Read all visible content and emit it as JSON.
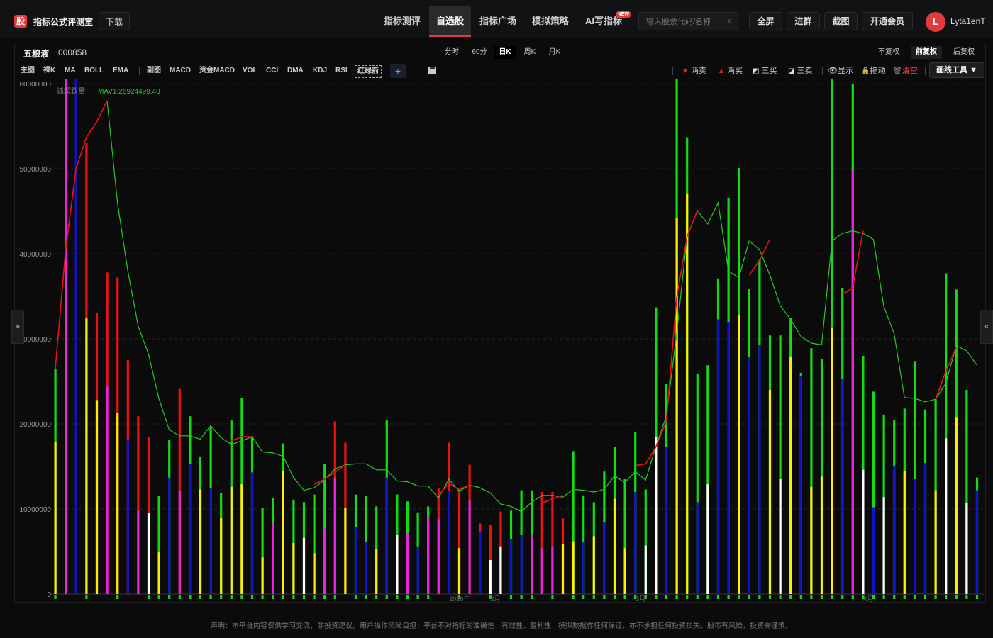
{
  "app": {
    "logo_char": "股",
    "title": "指标公式评测室",
    "download": "下载"
  },
  "nav": [
    "指标测评",
    "自选股",
    "指标广场",
    "模拟策略",
    "AI写指标"
  ],
  "nav_active": 1,
  "new_badge": "NEW",
  "search": {
    "placeholder": "输入股票代码/名称"
  },
  "top_buttons": [
    "全屏",
    "进群",
    "截图",
    "开通会员"
  ],
  "user": {
    "initial": "L",
    "name": "Lyta1enT"
  },
  "stock": {
    "name": "五粮液",
    "code": "000858"
  },
  "periods": [
    "分时",
    "60分",
    "日K",
    "周K",
    "月K"
  ],
  "period_active": 2,
  "adjust": [
    "不复权",
    "前复权",
    "后复权"
  ],
  "adjust_active": 1,
  "indicators_main": [
    "主图",
    "裸K",
    "MA",
    "BOLL",
    "EMA"
  ],
  "indicators_sub": [
    "副图",
    "MACD",
    "资金MACD",
    "VOL",
    "CCI",
    "DMA",
    "KDJ",
    "RSI",
    "红绿箭"
  ],
  "add_label": "+",
  "draw_tools": [
    "两卖",
    "两买",
    "三买",
    "三卖",
    "显示",
    "拖动",
    "清空"
  ],
  "draw_tools_button": "画线工具 ▼",
  "side_left": "»",
  "side_right": "«",
  "disclaimer": "声明：本平台内容仅供学习交流，非投资建议。用户操作风险自担；平台不对指标的准确性、有效性、盈利性、模拟数据作任何保证，亦不承担任何投资损失。股市有风险，投资需谨慎。",
  "chart_data": {
    "type": "bar",
    "legend": [
      {
        "name": "抓超跌量",
        "color": "#888888"
      },
      {
        "name": "MAV1:26924499.40",
        "color": "#22cc22"
      }
    ],
    "y_ticks": [
      0,
      10000000,
      20000000,
      30000000,
      40000000,
      50000000,
      60000000
    ],
    "ylim": [
      0,
      60000000
    ],
    "x_labels": [
      {
        "index": 39,
        "text": "2026年"
      },
      {
        "index": 43,
        "text": "2月"
      },
      {
        "index": 57,
        "text": "3月"
      },
      {
        "index": 79,
        "text": "4月"
      }
    ],
    "colors": {
      "yellow": "#ffee00",
      "green": "#11dd11",
      "red": "#ee1111",
      "blue": "#1111cc",
      "magenta": "#ee22dd",
      "white": "#ffffff"
    },
    "bars": [
      {
        "upper": "green",
        "upper_val": 26500000,
        "lower": "yellow",
        "lower_val": 17900000
      },
      {
        "upper": "magenta",
        "upper_val": 60500000,
        "lower": "magenta",
        "lower_val": 60500000
      },
      {
        "upper": "blue",
        "upper_val": 60500000,
        "lower": "blue",
        "lower_val": 60500000
      },
      {
        "upper": "red",
        "upper_val": 53000000,
        "lower": "yellow",
        "lower_val": 32400000
      },
      {
        "upper": "red",
        "upper_val": 33000000,
        "lower": "yellow",
        "lower_val": 22800000
      },
      {
        "upper": "red",
        "upper_val": 37800000,
        "lower": "magenta",
        "lower_val": 24400000
      },
      {
        "upper": "red",
        "upper_val": 37200000,
        "lower": "yellow",
        "lower_val": 21300000
      },
      {
        "upper": "red",
        "upper_val": 27500000,
        "lower": "blue",
        "lower_val": 18100000
      },
      {
        "upper": "red",
        "upper_val": 20900000,
        "lower": "magenta",
        "lower_val": 9800000
      },
      {
        "upper": "red",
        "upper_val": 18500000,
        "lower": "white",
        "lower_val": 9500000
      },
      {
        "upper": "green",
        "upper_val": 11500000,
        "lower": "yellow",
        "lower_val": 4900000
      },
      {
        "upper": "green",
        "upper_val": 18100000,
        "lower": "blue",
        "lower_val": 13700000
      },
      {
        "upper": "red",
        "upper_val": 24100000,
        "lower": "magenta",
        "lower_val": 12100000
      },
      {
        "upper": "green",
        "upper_val": 20900000,
        "lower": "blue",
        "lower_val": 15300000
      },
      {
        "upper": "green",
        "upper_val": 16100000,
        "lower": "yellow",
        "lower_val": 12300000
      },
      {
        "upper": "green",
        "upper_val": 19600000,
        "lower": "blue",
        "lower_val": 12500000
      },
      {
        "upper": "green",
        "upper_val": 11900000,
        "lower": "yellow",
        "lower_val": 8900000
      },
      {
        "upper": "green",
        "upper_val": 20400000,
        "lower": "yellow",
        "lower_val": 12600000
      },
      {
        "upper": "green",
        "upper_val": 23000000,
        "lower": "yellow",
        "lower_val": 12900000
      },
      {
        "upper": "green",
        "upper_val": 18400000,
        "lower": "blue",
        "lower_val": 14300000
      },
      {
        "upper": "green",
        "upper_val": 10100000,
        "lower": "yellow",
        "lower_val": 4300000
      },
      {
        "upper": "green",
        "upper_val": 11300000,
        "lower": "magenta",
        "lower_val": 8300000
      },
      {
        "upper": "green",
        "upper_val": 17700000,
        "lower": "yellow",
        "lower_val": 14500000
      },
      {
        "upper": "green",
        "upper_val": 11100000,
        "lower": "yellow",
        "lower_val": 6000000
      },
      {
        "upper": "green",
        "upper_val": 10800000,
        "lower": "white",
        "lower_val": 6600000
      },
      {
        "upper": "green",
        "upper_val": 11700000,
        "lower": "yellow",
        "lower_val": 4800000
      },
      {
        "upper": "green",
        "upper_val": 15300000,
        "lower": "magenta",
        "lower_val": 7700000
      },
      {
        "upper": "red",
        "upper_val": 20300000,
        "lower": "magenta",
        "lower_val": 13700000
      },
      {
        "upper": "red",
        "upper_val": 17800000,
        "lower": "yellow",
        "lower_val": 10100000
      },
      {
        "upper": "green",
        "upper_val": 11700000,
        "lower": "blue",
        "lower_val": 7900000
      },
      {
        "upper": "green",
        "upper_val": 11500000,
        "lower": "blue",
        "lower_val": 6100000
      },
      {
        "upper": "green",
        "upper_val": 10300000,
        "lower": "yellow",
        "lower_val": 5300000
      },
      {
        "upper": "green",
        "upper_val": 20500000,
        "lower": "blue",
        "lower_val": 13700000
      },
      {
        "upper": "green",
        "upper_val": 11700000,
        "lower": "white",
        "lower_val": 7000000
      },
      {
        "upper": "green",
        "upper_val": 10900000,
        "lower": "magenta",
        "lower_val": 7100000
      },
      {
        "upper": "green",
        "upper_val": 9600000,
        "lower": "blue",
        "lower_val": 5600000
      },
      {
        "upper": "green",
        "upper_val": 10300000,
        "lower": "magenta",
        "lower_val": 9000000
      },
      {
        "upper": "red",
        "upper_val": 12400000,
        "lower": "magenta",
        "lower_val": 8800000
      },
      {
        "upper": "red",
        "upper_val": 17800000,
        "lower": "blue",
        "lower_val": 12100000
      },
      {
        "upper": "red",
        "upper_val": 12300000,
        "lower": "yellow",
        "lower_val": 5400000
      },
      {
        "upper": "red",
        "upper_val": 15200000,
        "lower": "magenta",
        "lower_val": 11000000
      },
      {
        "upper": "red",
        "upper_val": 8300000,
        "lower": "blue",
        "lower_val": 7300000
      },
      {
        "upper": "red",
        "upper_val": 8100000,
        "lower": "white",
        "lower_val": 4000000
      },
      {
        "upper": "red",
        "upper_val": 9700000,
        "lower": "white",
        "lower_val": 5600000
      },
      {
        "upper": "green",
        "upper_val": 9800000,
        "lower": "blue",
        "lower_val": 6500000
      },
      {
        "upper": "green",
        "upper_val": 12200000,
        "lower": "blue",
        "lower_val": 7000000
      },
      {
        "upper": "green",
        "upper_val": 12200000,
        "lower": "magenta",
        "lower_val": 7000000
      },
      {
        "upper": "red",
        "upper_val": 12000000,
        "lower": "magenta",
        "lower_val": 5400000
      },
      {
        "upper": "red",
        "upper_val": 12000000,
        "lower": "magenta",
        "lower_val": 5600000
      },
      {
        "upper": "red",
        "upper_val": 8900000,
        "lower": "yellow",
        "lower_val": 5900000
      },
      {
        "upper": "green",
        "upper_val": 16800000,
        "lower": "yellow",
        "lower_val": 6200000
      },
      {
        "upper": "green",
        "upper_val": 11600000,
        "lower": "blue",
        "lower_val": 6100000
      },
      {
        "upper": "green",
        "upper_val": 10800000,
        "lower": "yellow",
        "lower_val": 6800000
      },
      {
        "upper": "green",
        "upper_val": 14400000,
        "lower": "blue",
        "lower_val": 8400000
      },
      {
        "upper": "green",
        "upper_val": 17300000,
        "lower": "yellow",
        "lower_val": 11200000
      },
      {
        "upper": "green",
        "upper_val": 13500000,
        "lower": "yellow",
        "lower_val": 5400000
      },
      {
        "upper": "green",
        "upper_val": 19000000,
        "lower": "blue",
        "lower_val": 12000000
      },
      {
        "upper": "green",
        "upper_val": 12300000,
        "lower": "white",
        "lower_val": 5700000
      },
      {
        "upper": "green",
        "upper_val": 33700000,
        "lower": "white",
        "lower_val": 18500000
      },
      {
        "upper": "green",
        "upper_val": 24700000,
        "lower": "blue",
        "lower_val": 17300000
      },
      {
        "upper": "green",
        "upper_val": 60500000,
        "lower": "yellow",
        "lower_val": 44200000
      },
      {
        "upper": "green",
        "upper_val": 53700000,
        "lower": "yellow",
        "lower_val": 47100000
      },
      {
        "upper": "green",
        "upper_val": 25900000,
        "lower": "blue",
        "lower_val": 10800000
      },
      {
        "upper": "green",
        "upper_val": 26900000,
        "lower": "white",
        "lower_val": 12900000
      },
      {
        "upper": "green",
        "upper_val": 37100000,
        "lower": "blue",
        "lower_val": 32300000
      },
      {
        "upper": "green",
        "upper_val": 46600000,
        "lower": "blue",
        "lower_val": 32000000
      },
      {
        "upper": "green",
        "upper_val": 50100000,
        "lower": "yellow",
        "lower_val": 32800000
      },
      {
        "upper": "green",
        "upper_val": 35900000,
        "lower": "blue",
        "lower_val": 27900000
      },
      {
        "upper": "green",
        "upper_val": 39300000,
        "lower": "blue",
        "lower_val": 29300000
      },
      {
        "upper": "green",
        "upper_val": 30400000,
        "lower": "yellow",
        "lower_val": 24000000
      },
      {
        "upper": "green",
        "upper_val": 30400000,
        "lower": "white",
        "lower_val": 13500000
      },
      {
        "upper": "green",
        "upper_val": 32500000,
        "lower": "yellow",
        "lower_val": 27900000
      },
      {
        "upper": "green",
        "upper_val": 26000000,
        "lower": "blue",
        "lower_val": 25600000
      },
      {
        "upper": "green",
        "upper_val": 28900000,
        "lower": "yellow",
        "lower_val": 12600000
      },
      {
        "upper": "green",
        "upper_val": 27600000,
        "lower": "yellow",
        "lower_val": 13800000
      },
      {
        "upper": "green",
        "upper_val": 60500000,
        "lower": "yellow",
        "lower_val": 31300000
      },
      {
        "upper": "green",
        "upper_val": 36000000,
        "lower": "blue",
        "lower_val": 25300000
      },
      {
        "upper": "green",
        "upper_val": 60000000,
        "lower": "magenta",
        "lower_val": 49800000
      },
      {
        "upper": "green",
        "upper_val": 28000000,
        "lower": "white",
        "lower_val": 14600000
      },
      {
        "upper": "green",
        "upper_val": 23800000,
        "lower": "blue",
        "lower_val": 10200000
      },
      {
        "upper": "green",
        "upper_val": 21100000,
        "lower": "white",
        "lower_val": 11400000
      },
      {
        "upper": "green",
        "upper_val": 20400000,
        "lower": "blue",
        "lower_val": 15100000
      },
      {
        "upper": "green",
        "upper_val": 21800000,
        "lower": "yellow",
        "lower_val": 14500000
      },
      {
        "upper": "green",
        "upper_val": 27400000,
        "lower": "blue",
        "lower_val": 13500000
      },
      {
        "upper": "green",
        "upper_val": 21700000,
        "lower": "blue",
        "lower_val": 15400000
      },
      {
        "upper": "green",
        "upper_val": 22900000,
        "lower": "yellow",
        "lower_val": 12200000
      },
      {
        "upper": "green",
        "upper_val": 37700000,
        "lower": "white",
        "lower_val": 18300000
      },
      {
        "upper": "green",
        "upper_val": 35800000,
        "lower": "yellow",
        "lower_val": 20800000
      },
      {
        "upper": "green",
        "upper_val": 24000000,
        "lower": "white",
        "lower_val": 10700000
      },
      {
        "upper": "green",
        "upper_val": 13700000,
        "lower": "blue",
        "lower_val": 12200000
      }
    ],
    "mav1": [
      null,
      null,
      null,
      null,
      null,
      58000000,
      46000000,
      38000000,
      31500000,
      28200000,
      23000000,
      19300000,
      18600000,
      18600000,
      18200000,
      19800000,
      18400000,
      17600000,
      18000000,
      18500000,
      16700000,
      16600000,
      16200000,
      13700000,
      12200000,
      12500000,
      13400000,
      14700000,
      15200000,
      15300000,
      15300000,
      14600000,
      14600000,
      13300000,
      13200000,
      12700000,
      12700000,
      11300000,
      13500000,
      12100000,
      12800000,
      12500000,
      11900000,
      10600000,
      10300000,
      9700000,
      10800000,
      11600000,
      11600000,
      11400000,
      12300000,
      12200000,
      12000000,
      12300000,
      13900000,
      13100000,
      14400000,
      13400000,
      17400000,
      20900000,
      30600000,
      42000000,
      45100000,
      43500000,
      46000000,
      38000000,
      37200000,
      41500000,
      40500000,
      37500000,
      33900000,
      32300000,
      30300000,
      29500000,
      29300000,
      41500000,
      42400000,
      42700000,
      42400000,
      41700000,
      33800000,
      30600000,
      23100000,
      23000000,
      22600000,
      22900000,
      24800000,
      29200000,
      28600000,
      26900000
    ],
    "red_line": [
      {
        "i": 0,
        "v": 26500000
      },
      {
        "i": 1,
        "v": 40500000
      },
      {
        "i": 2,
        "v": 50000000
      },
      {
        "i": 3,
        "v": 53700000
      },
      {
        "i": 4,
        "v": 55500000
      },
      {
        "i": 5,
        "v": 58000000
      },
      {
        "i": 17,
        "v": 18000000
      },
      {
        "i": 18,
        "v": 18500000
      },
      {
        "i": 19,
        "v": 18500000
      },
      {
        "i": 25,
        "v": 12900000
      },
      {
        "i": 26,
        "v": 13500000
      },
      {
        "i": 27,
        "v": 14300000
      },
      {
        "i": 28,
        "v": 15200000
      },
      {
        "i": 37,
        "v": 11600000
      },
      {
        "i": 38,
        "v": 13000000
      },
      {
        "i": 39,
        "v": 12300000
      },
      {
        "i": 40,
        "v": 12800000
      },
      {
        "i": 47,
        "v": 10700000
      },
      {
        "i": 48,
        "v": 11200000
      },
      {
        "i": 49,
        "v": 11600000
      },
      {
        "i": 56,
        "v": 15100000
      },
      {
        "i": 57,
        "v": 15300000
      },
      {
        "i": 58,
        "v": 17300000
      },
      {
        "i": 59,
        "v": 20300000
      },
      {
        "i": 60,
        "v": 34800000
      },
      {
        "i": 61,
        "v": 42000000
      },
      {
        "i": 62,
        "v": 45100000
      },
      {
        "i": 67,
        "v": 37500000
      },
      {
        "i": 68,
        "v": 39200000
      },
      {
        "i": 69,
        "v": 41700000
      },
      {
        "i": 76,
        "v": 35200000
      },
      {
        "i": 77,
        "v": 36000000
      },
      {
        "i": 78,
        "v": 42700000
      },
      {
        "i": 85,
        "v": 22900000
      },
      {
        "i": 86,
        "v": 26200000
      },
      {
        "i": 87,
        "v": 29000000
      }
    ]
  }
}
